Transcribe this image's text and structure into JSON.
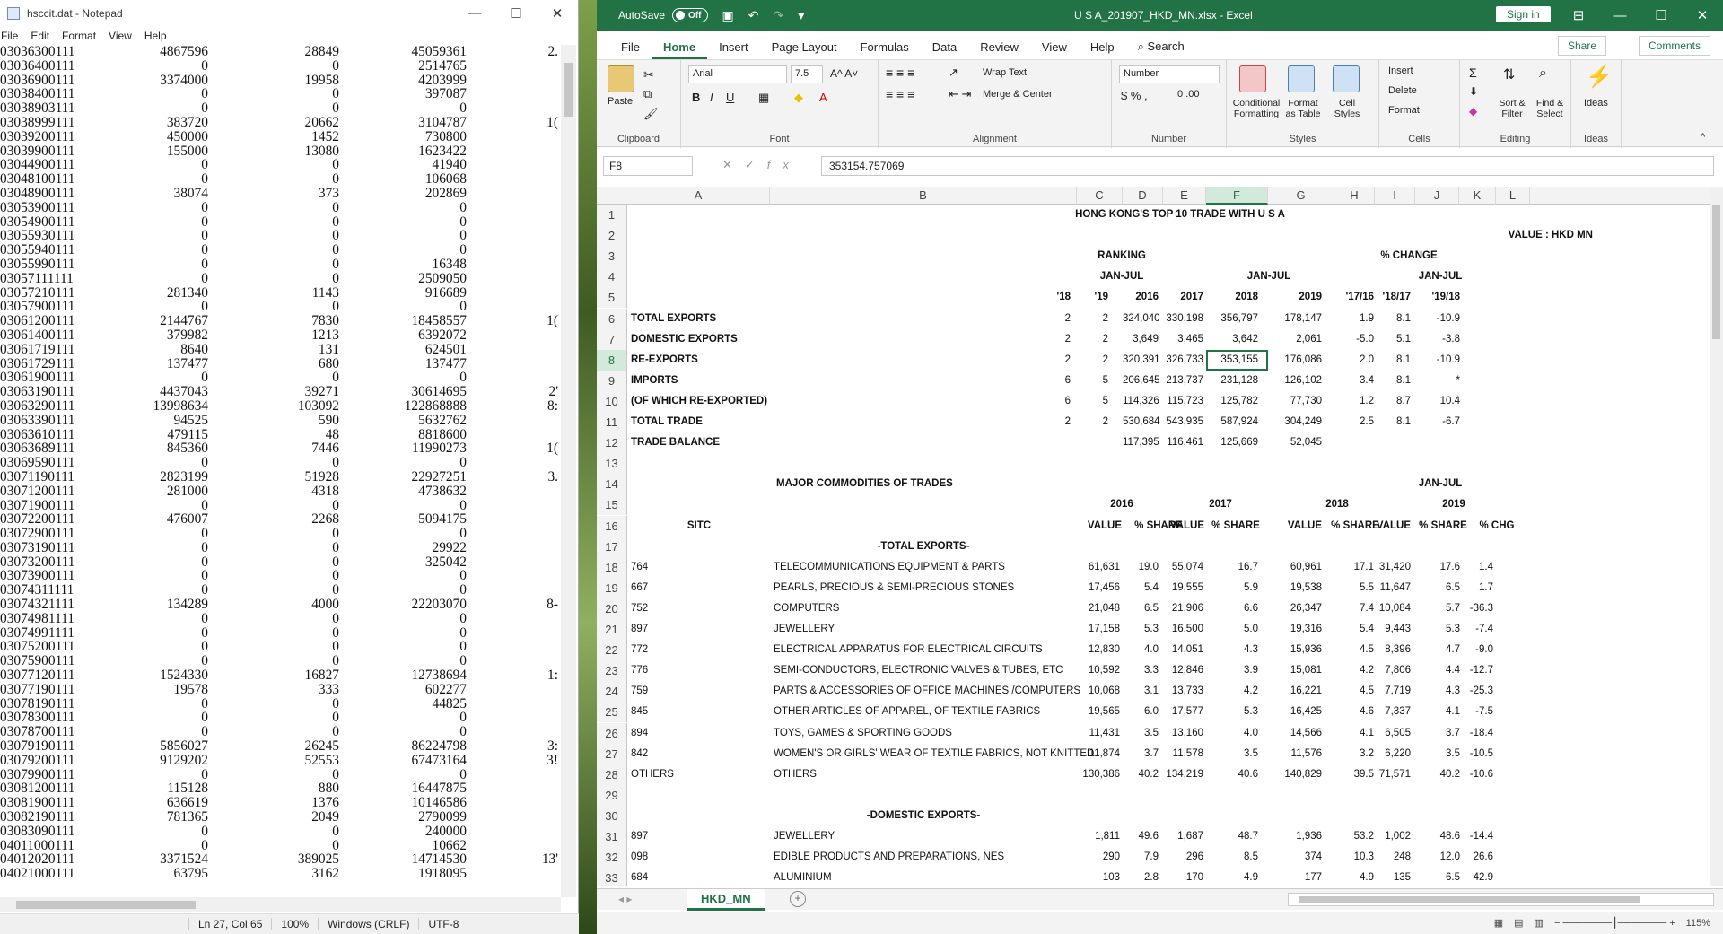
{
  "notepad": {
    "title": "hsccit.dat - Notepad",
    "menu": [
      "File",
      "Edit",
      "Format",
      "View",
      "Help"
    ],
    "rows": [
      [
        "03036300111",
        "4867596",
        "28849",
        "45059361",
        "2."
      ],
      [
        "03036400111",
        "0",
        "0",
        "2514765",
        ""
      ],
      [
        "03036900111",
        "3374000",
        "19958",
        "4203999",
        ""
      ],
      [
        "03038400111",
        "0",
        "0",
        "397087",
        ""
      ],
      [
        "03038903111",
        "0",
        "0",
        "0",
        ""
      ],
      [
        "03038999111",
        "383720",
        "20662",
        "3104787",
        "1("
      ],
      [
        "03039200111",
        "450000",
        "1452",
        "730800",
        ""
      ],
      [
        "03039900111",
        "155000",
        "13080",
        "1623422",
        ""
      ],
      [
        "03044900111",
        "0",
        "0",
        "41940",
        ""
      ],
      [
        "03048100111",
        "0",
        "0",
        "106068",
        ""
      ],
      [
        "03048900111",
        "38074",
        "373",
        "202869",
        ""
      ],
      [
        "03053900111",
        "0",
        "0",
        "0",
        ""
      ],
      [
        "03054900111",
        "0",
        "0",
        "0",
        ""
      ],
      [
        "03055930111",
        "0",
        "0",
        "0",
        ""
      ],
      [
        "03055940111",
        "0",
        "0",
        "0",
        ""
      ],
      [
        "03055990111",
        "0",
        "0",
        "16348",
        ""
      ],
      [
        "03057111111",
        "0",
        "0",
        "2509050",
        ""
      ],
      [
        "03057210111",
        "281340",
        "1143",
        "916689",
        ""
      ],
      [
        "03057900111",
        "0",
        "0",
        "0",
        ""
      ],
      [
        "03061200111",
        "2144767",
        "7830",
        "18458557",
        "1("
      ],
      [
        "03061400111",
        "379982",
        "1213",
        "6392072",
        ""
      ],
      [
        "03061719111",
        "8640",
        "131",
        "624501",
        ""
      ],
      [
        "03061729111",
        "137477",
        "680",
        "137477",
        ""
      ],
      [
        "03061900111",
        "0",
        "0",
        "0",
        ""
      ],
      [
        "03063190111",
        "4437043",
        "39271",
        "30614695",
        "2'"
      ],
      [
        "03063290111",
        "13998634",
        "103092",
        "122868888",
        "8:"
      ],
      [
        "03063390111",
        "94525",
        "590",
        "5632762",
        ""
      ],
      [
        "03063610111",
        "479115",
        "48",
        "8818600",
        ""
      ],
      [
        "03063689111",
        "845360",
        "7446",
        "11990273",
        "1("
      ],
      [
        "03069590111",
        "0",
        "0",
        "0",
        ""
      ],
      [
        "03071190111",
        "2823199",
        "51928",
        "22927251",
        "3."
      ],
      [
        "03071200111",
        "281000",
        "4318",
        "4738632",
        ""
      ],
      [
        "03071900111",
        "0",
        "0",
        "0",
        ""
      ],
      [
        "03072200111",
        "476007",
        "2268",
        "5094175",
        ""
      ],
      [
        "03072900111",
        "0",
        "0",
        "0",
        ""
      ],
      [
        "03073190111",
        "0",
        "0",
        "29922",
        ""
      ],
      [
        "03073200111",
        "0",
        "0",
        "325042",
        ""
      ],
      [
        "03073900111",
        "0",
        "0",
        "0",
        ""
      ],
      [
        "03074311111",
        "0",
        "0",
        "0",
        ""
      ],
      [
        "03074321111",
        "134289",
        "4000",
        "22203070",
        "8-"
      ],
      [
        "03074981111",
        "0",
        "0",
        "0",
        ""
      ],
      [
        "03074991111",
        "0",
        "0",
        "0",
        ""
      ],
      [
        "03075200111",
        "0",
        "0",
        "0",
        ""
      ],
      [
        "03075900111",
        "0",
        "0",
        "0",
        ""
      ],
      [
        "03077120111",
        "1524330",
        "16827",
        "12738694",
        "1:"
      ],
      [
        "03077190111",
        "19578",
        "333",
        "602277",
        ""
      ],
      [
        "03078190111",
        "0",
        "0",
        "44825",
        ""
      ],
      [
        "03078300111",
        "0",
        "0",
        "0",
        ""
      ],
      [
        "03078700111",
        "0",
        "0",
        "0",
        ""
      ],
      [
        "03079190111",
        "5856027",
        "26245",
        "86224798",
        "3:"
      ],
      [
        "03079200111",
        "9129202",
        "52553",
        "67473164",
        "3!"
      ],
      [
        "03079900111",
        "0",
        "0",
        "0",
        ""
      ],
      [
        "03081200111",
        "115128",
        "880",
        "16447875",
        ""
      ],
      [
        "03081900111",
        "636619",
        "1376",
        "10146586",
        ""
      ],
      [
        "03082190111",
        "781365",
        "2049",
        "2790099",
        ""
      ],
      [
        "03083090111",
        "0",
        "0",
        "240000",
        ""
      ],
      [
        "04011000111",
        "0",
        "0",
        "10662",
        ""
      ],
      [
        "04012020111",
        "3371524",
        "389025",
        "14714530",
        "13'"
      ],
      [
        "04021000111",
        "63795",
        "3162",
        "1918095",
        ""
      ]
    ],
    "status": {
      "position": "Ln 27, Col 65",
      "zoom": "100%",
      "eol": "Windows (CRLF)",
      "encoding": "UTF-8"
    }
  },
  "excel": {
    "autosave": "AutoSave",
    "autosave_state": "Off",
    "file_title": "U S A_201907_HKD_MN.xlsx - Excel",
    "signin": "Sign in",
    "tabs": [
      "File",
      "Home",
      "Insert",
      "Page Layout",
      "Formulas",
      "Data",
      "Review",
      "View",
      "Help"
    ],
    "search": "Search",
    "share": "Share",
    "comments": "Comments",
    "ribbon": {
      "paste": "Paste",
      "clipboard": "Clipboard",
      "font_name": "Arial",
      "font_size": "7.5",
      "font": "Font",
      "wrap_text": "Wrap Text",
      "merge_center": "Merge & Center",
      "alignment": "Alignment",
      "number_format": "Number",
      "number": "Number",
      "cond_fmt": "Conditional Formatting",
      "format_table": "Format as Table",
      "cell_styles": "Cell Styles",
      "styles": "Styles",
      "insert": "Insert",
      "delete": "Delete",
      "format": "Format",
      "cells": "Cells",
      "sort_filter": "Sort & Filter",
      "find_select": "Find & Select",
      "editing": "Editing",
      "ideas": "Ideas",
      "ideas_group": "Ideas"
    },
    "name_box": "F8",
    "formula": "353154.757069",
    "columns": [
      "A",
      "B",
      "C",
      "D",
      "E",
      "F",
      "G",
      "H",
      "I",
      "J",
      "K",
      "L"
    ],
    "sheet_tab": "HKD_MN",
    "zoom": "115%",
    "cells": {
      "r1": "HONG KONG'S TOP 10 TRADE WITH U S A",
      "r2_value": "VALUE : HKD MN",
      "r3_ranking": "RANKING",
      "r3_pct": "% CHANGE",
      "r4_janjul_a": "JAN-JUL",
      "r4_janjul_b": "JAN-JUL",
      "r4_janjul_c": "JAN-JUL",
      "r5": [
        "'18",
        "'19",
        "2016",
        "2017",
        "2018",
        "2019",
        "'17/16",
        "'18/17",
        "'19/18"
      ],
      "summary": [
        {
          "label": "TOTAL EXPORTS",
          "c18": "2",
          "c19": "2",
          "v16": "324,040",
          "v17": "330,198",
          "v18": "356,797",
          "v19": "178,147",
          "p1": "1.9",
          "p2": "8.1",
          "p3": "-10.9"
        },
        {
          "label": "DOMESTIC EXPORTS",
          "c18": "2",
          "c19": "2",
          "v16": "3,649",
          "v17": "3,465",
          "v18": "3,642",
          "v19": "2,061",
          "p1": "-5.0",
          "p2": "5.1",
          "p3": "-3.8"
        },
        {
          "label": "RE-EXPORTS",
          "c18": "2",
          "c19": "2",
          "v16": "320,391",
          "v17": "326,733",
          "v18": "353,155",
          "v19": "176,086",
          "p1": "2.0",
          "p2": "8.1",
          "p3": "-10.9"
        },
        {
          "label": "IMPORTS",
          "c18": "6",
          "c19": "5",
          "v16": "206,645",
          "v17": "213,737",
          "v18": "231,128",
          "v19": "126,102",
          "p1": "3.4",
          "p2": "8.1",
          "p3": "*"
        },
        {
          "label": "(OF WHICH RE-EXPORTED)",
          "c18": "6",
          "c19": "5",
          "v16": "114,326",
          "v17": "115,723",
          "v18": "125,782",
          "v19": "77,730",
          "p1": "1.2",
          "p2": "8.7",
          "p3": "10.4"
        },
        {
          "label": "TOTAL TRADE",
          "c18": "2",
          "c19": "2",
          "v16": "530,684",
          "v17": "543,935",
          "v18": "587,924",
          "v19": "304,249",
          "p1": "2.5",
          "p2": "8.1",
          "p3": "-6.7"
        },
        {
          "label": "TRADE BALANCE",
          "c18": "",
          "c19": "",
          "v16": "117,395",
          "v17": "116,461",
          "v18": "125,669",
          "v19": "52,045",
          "p1": "",
          "p2": "",
          "p3": ""
        }
      ],
      "r14_major": "MAJOR COMMODITIES OF TRADES",
      "r14_janjul": "JAN-JUL",
      "r15": [
        "2016",
        "2017",
        "2018",
        "2019"
      ],
      "r16": [
        "SITC",
        "VALUE",
        "% SHARE",
        "VALUE",
        "% SHARE",
        "VALUE",
        "% SHARE",
        "VALUE",
        "% SHARE",
        "% CHG"
      ],
      "r17": "-TOTAL EXPORTS-",
      "commodities": [
        {
          "sitc": "764",
          "desc": "TELECOMMUNICATIONS EQUIPMENT & PARTS",
          "a": "61,631",
          "b": "19.0",
          "c": "55,074",
          "d": "16.7",
          "e": "60,961",
          "f": "17.1",
          "g": "31,420",
          "h": "17.6",
          "i": "1.4"
        },
        {
          "sitc": "667",
          "desc": "PEARLS, PRECIOUS & SEMI-PRECIOUS STONES",
          "a": "17,456",
          "b": "5.4",
          "c": "19,555",
          "d": "5.9",
          "e": "19,538",
          "f": "5.5",
          "g": "11,647",
          "h": "6.5",
          "i": "1.7"
        },
        {
          "sitc": "752",
          "desc": "COMPUTERS",
          "a": "21,048",
          "b": "6.5",
          "c": "21,906",
          "d": "6.6",
          "e": "26,347",
          "f": "7.4",
          "g": "10,084",
          "h": "5.7",
          "i": "-36.3"
        },
        {
          "sitc": "897",
          "desc": "JEWELLERY",
          "a": "17,158",
          "b": "5.3",
          "c": "16,500",
          "d": "5.0",
          "e": "19,316",
          "f": "5.4",
          "g": "9,443",
          "h": "5.3",
          "i": "-7.4"
        },
        {
          "sitc": "772",
          "desc": "ELECTRICAL APPARATUS FOR ELECTRICAL CIRCUITS",
          "a": "12,830",
          "b": "4.0",
          "c": "14,051",
          "d": "4.3",
          "e": "15,936",
          "f": "4.5",
          "g": "8,396",
          "h": "4.7",
          "i": "-9.0"
        },
        {
          "sitc": "776",
          "desc": "SEMI-CONDUCTORS, ELECTRONIC VALVES & TUBES, ETC",
          "a": "10,592",
          "b": "3.3",
          "c": "12,846",
          "d": "3.9",
          "e": "15,081",
          "f": "4.2",
          "g": "7,806",
          "h": "4.4",
          "i": "-12.7"
        },
        {
          "sitc": "759",
          "desc": "PARTS & ACCESSORIES OF OFFICE MACHINES /COMPUTERS",
          "a": "10,068",
          "b": "3.1",
          "c": "13,733",
          "d": "4.2",
          "e": "16,221",
          "f": "4.5",
          "g": "7,719",
          "h": "4.3",
          "i": "-25.3"
        },
        {
          "sitc": "845",
          "desc": "OTHER ARTICLES OF APPAREL, OF TEXTILE FABRICS",
          "a": "19,565",
          "b": "6.0",
          "c": "17,577",
          "d": "5.3",
          "e": "16,425",
          "f": "4.6",
          "g": "7,337",
          "h": "4.1",
          "i": "-7.5"
        },
        {
          "sitc": "894",
          "desc": "TOYS, GAMES & SPORTING GOODS",
          "a": "11,431",
          "b": "3.5",
          "c": "13,160",
          "d": "4.0",
          "e": "14,566",
          "f": "4.1",
          "g": "6,505",
          "h": "3.7",
          "i": "-18.4"
        },
        {
          "sitc": "842",
          "desc": "WOMEN'S OR GIRLS' WEAR OF TEXTILE FABRICS, NOT KNITTED",
          "a": "11,874",
          "b": "3.7",
          "c": "11,578",
          "d": "3.5",
          "e": "11,576",
          "f": "3.2",
          "g": "6,220",
          "h": "3.5",
          "i": "-10.5"
        },
        {
          "sitc": "OTHERS",
          "desc": "OTHERS",
          "a": "130,386",
          "b": "40.2",
          "c": "134,219",
          "d": "40.6",
          "e": "140,829",
          "f": "39.5",
          "g": "71,571",
          "h": "40.2",
          "i": "-10.6"
        }
      ],
      "r30": "-DOMESTIC EXPORTS-",
      "domestic": [
        {
          "sitc": "897",
          "desc": "JEWELLERY",
          "a": "1,811",
          "b": "49.6",
          "c": "1,687",
          "d": "48.7",
          "e": "1,936",
          "f": "53.2",
          "g": "1,002",
          "h": "48.6",
          "i": "-14.4"
        },
        {
          "sitc": "098",
          "desc": "EDIBLE PRODUCTS AND PREPARATIONS, NES",
          "a": "290",
          "b": "7.9",
          "c": "296",
          "d": "8.5",
          "e": "374",
          "f": "10.3",
          "g": "248",
          "h": "12.0",
          "i": "26.6"
        },
        {
          "sitc": "684",
          "desc": "ALUMINIUM",
          "a": "103",
          "b": "2.8",
          "c": "170",
          "d": "4.9",
          "e": "177",
          "f": "4.9",
          "g": "135",
          "h": "6.5",
          "i": "42.9"
        }
      ]
    }
  }
}
